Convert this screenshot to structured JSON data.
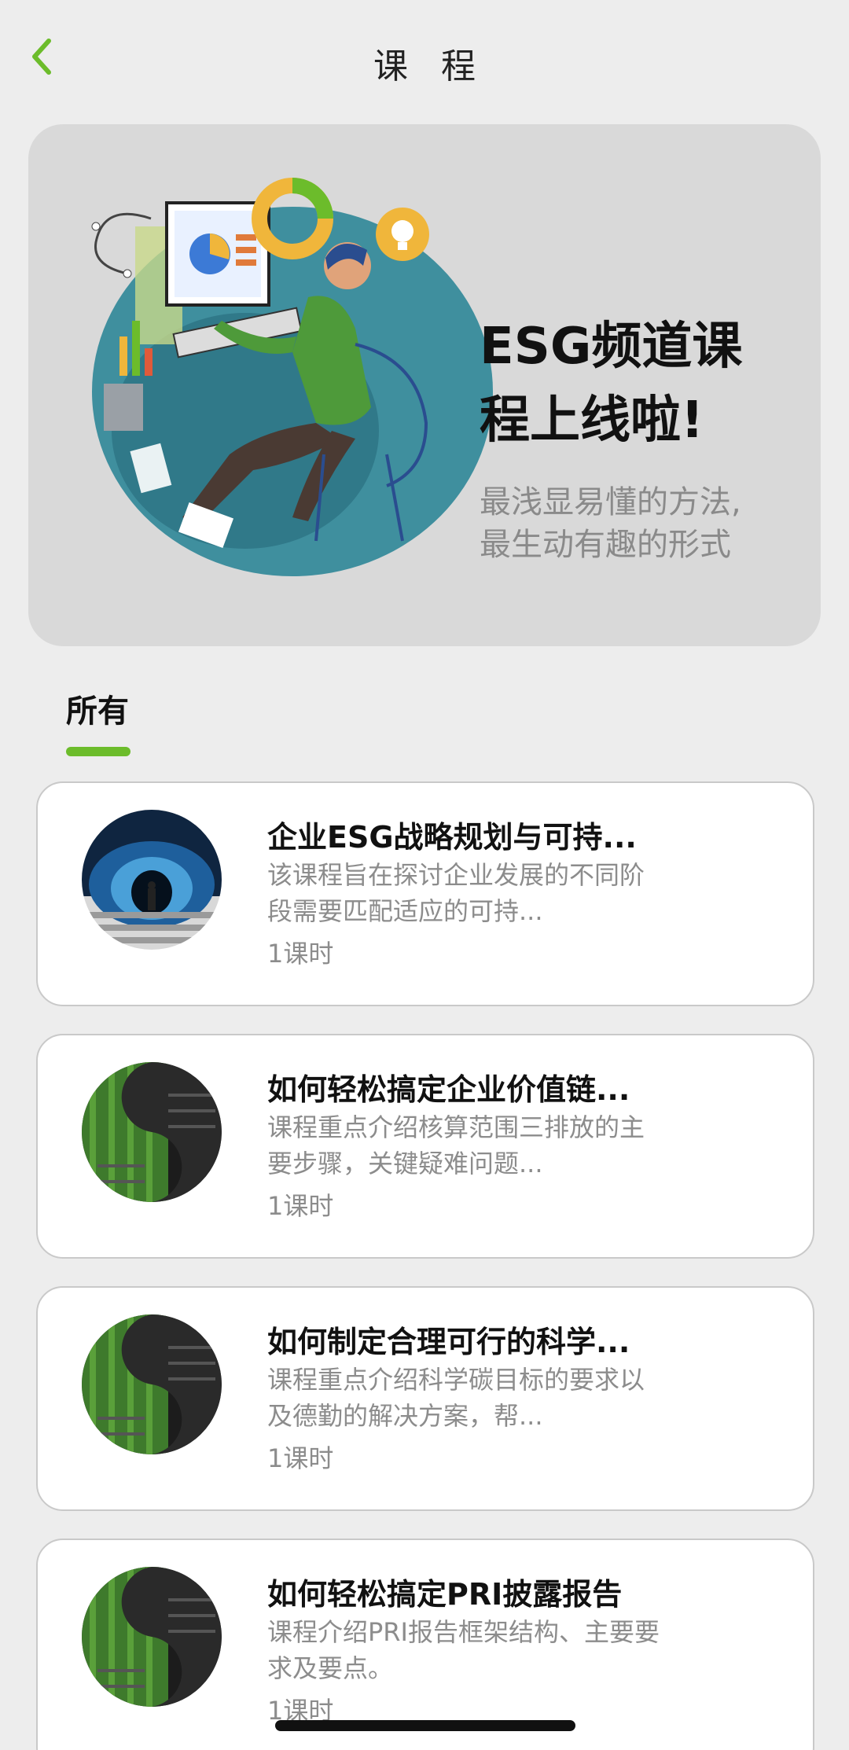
{
  "header": {
    "title": "课 程",
    "back_icon": "chevron-left-icon",
    "accent_color": "#6cbc2b"
  },
  "banner": {
    "title_line1": "ESG频道课",
    "title_line2": "程上线啦!",
    "subtitle_line1": "最浅显易懂的方法,",
    "subtitle_line2": "最生动有趣的形式"
  },
  "tabs": [
    {
      "label": "所有",
      "active": true
    }
  ],
  "courses": [
    {
      "title": "企业ESG战略规划与可持...",
      "description": "该课程旨在探讨企业发展的不同阶段需要匹配适应的可持...",
      "meta": "1课时",
      "thumb": "tunnel"
    },
    {
      "title": "如何轻松搞定企业价值链...",
      "description": "课程重点介绍核算范围三排放的主要步骤，关键疑难问题...",
      "meta": "1课时",
      "thumb": "green"
    },
    {
      "title": "如何制定合理可行的科学...",
      "description": "课程重点介绍科学碳目标的要求以及德勤的解决方案，帮...",
      "meta": "1课时",
      "thumb": "green"
    },
    {
      "title": "如何轻松搞定PRI披露报告",
      "description": "课程介绍PRI报告框架结构、主要要求及要点。",
      "meta": "1课时",
      "thumb": "green"
    }
  ]
}
